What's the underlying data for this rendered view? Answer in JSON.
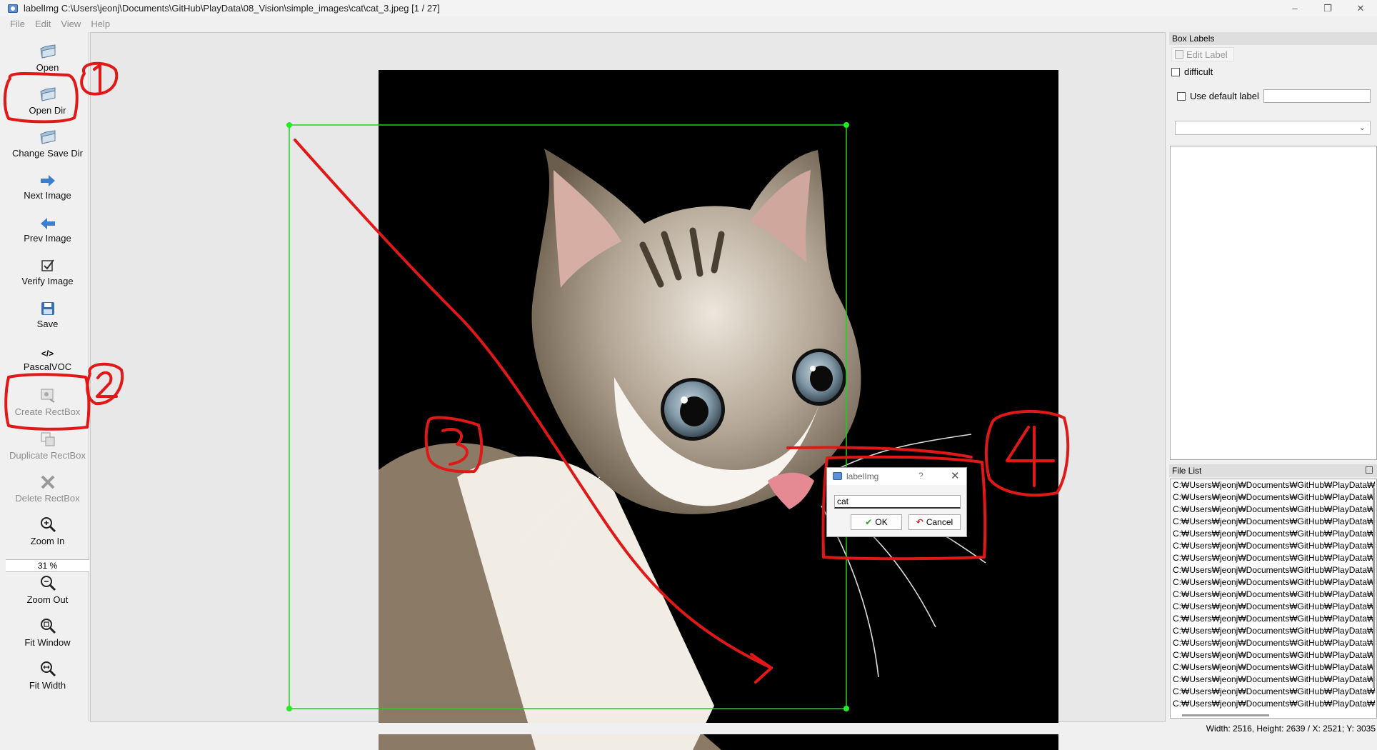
{
  "window": {
    "title": "labelImg C:\\Users\\jeonj\\Documents\\GitHub\\PlayData\\08_Vision\\simple_images\\cat\\cat_3.jpeg [1 / 27]",
    "minimize": "–",
    "maximize": "❐",
    "close": "✕"
  },
  "menu": [
    "File",
    "Edit",
    "View",
    "Help"
  ],
  "toolbar": {
    "open": "Open",
    "open_dir": "Open Dir",
    "change_save_dir": "Change Save Dir",
    "next_image": "Next Image",
    "prev_image": "Prev Image",
    "verify_image": "Verify Image",
    "save": "Save",
    "format_icon": "</>",
    "format": "PascalVOC",
    "create_rectbox": "Create RectBox",
    "duplicate_rectbox": "Duplicate RectBox",
    "delete_rectbox": "Delete RectBox",
    "zoom_in": "Zoom In",
    "zoom_level": "31 %",
    "zoom_out": "Zoom Out",
    "fit_window": "Fit Window",
    "fit_width": "Fit Width"
  },
  "box_labels": {
    "title": "Box Labels",
    "edit_label": "Edit Label",
    "difficult": "difficult",
    "use_default_label": "Use default label",
    "default_label_value": ""
  },
  "file_list": {
    "title": "File List",
    "rows": [
      "C:₩Users₩jeonj₩Documents₩GitHub₩PlayData₩",
      "C:₩Users₩jeonj₩Documents₩GitHub₩PlayData₩",
      "C:₩Users₩jeonj₩Documents₩GitHub₩PlayData₩",
      "C:₩Users₩jeonj₩Documents₩GitHub₩PlayData₩",
      "C:₩Users₩jeonj₩Documents₩GitHub₩PlayData₩",
      "C:₩Users₩jeonj₩Documents₩GitHub₩PlayData₩",
      "C:₩Users₩jeonj₩Documents₩GitHub₩PlayData₩",
      "C:₩Users₩jeonj₩Documents₩GitHub₩PlayData₩",
      "C:₩Users₩jeonj₩Documents₩GitHub₩PlayData₩",
      "C:₩Users₩jeonj₩Documents₩GitHub₩PlayData₩",
      "C:₩Users₩jeonj₩Documents₩GitHub₩PlayData₩",
      "C:₩Users₩jeonj₩Documents₩GitHub₩PlayData₩",
      "C:₩Users₩jeonj₩Documents₩GitHub₩PlayData₩",
      "C:₩Users₩jeonj₩Documents₩GitHub₩PlayData₩",
      "C:₩Users₩jeonj₩Documents₩GitHub₩PlayData₩",
      "C:₩Users₩jeonj₩Documents₩GitHub₩PlayData₩",
      "C:₩Users₩jeonj₩Documents₩GitHub₩PlayData₩",
      "C:₩Users₩jeonj₩Documents₩GitHub₩PlayData₩",
      "C:₩Users₩jeonj₩Documents₩GitHub₩PlayData₩"
    ]
  },
  "status": "Width: 2516, Height: 2639 / X: 2521; Y: 3035",
  "dialog": {
    "title": "labelImg",
    "help": "?",
    "close": "✕",
    "input_value": "cat",
    "ok": "OK",
    "cancel": "Cancel"
  },
  "annotations": {
    "n1": "1",
    "n2": "2",
    "n3": "3",
    "n4": "4",
    "color": "#e01818"
  },
  "colors": {
    "bbox": "#22cc22",
    "image_bg": "#000000"
  }
}
